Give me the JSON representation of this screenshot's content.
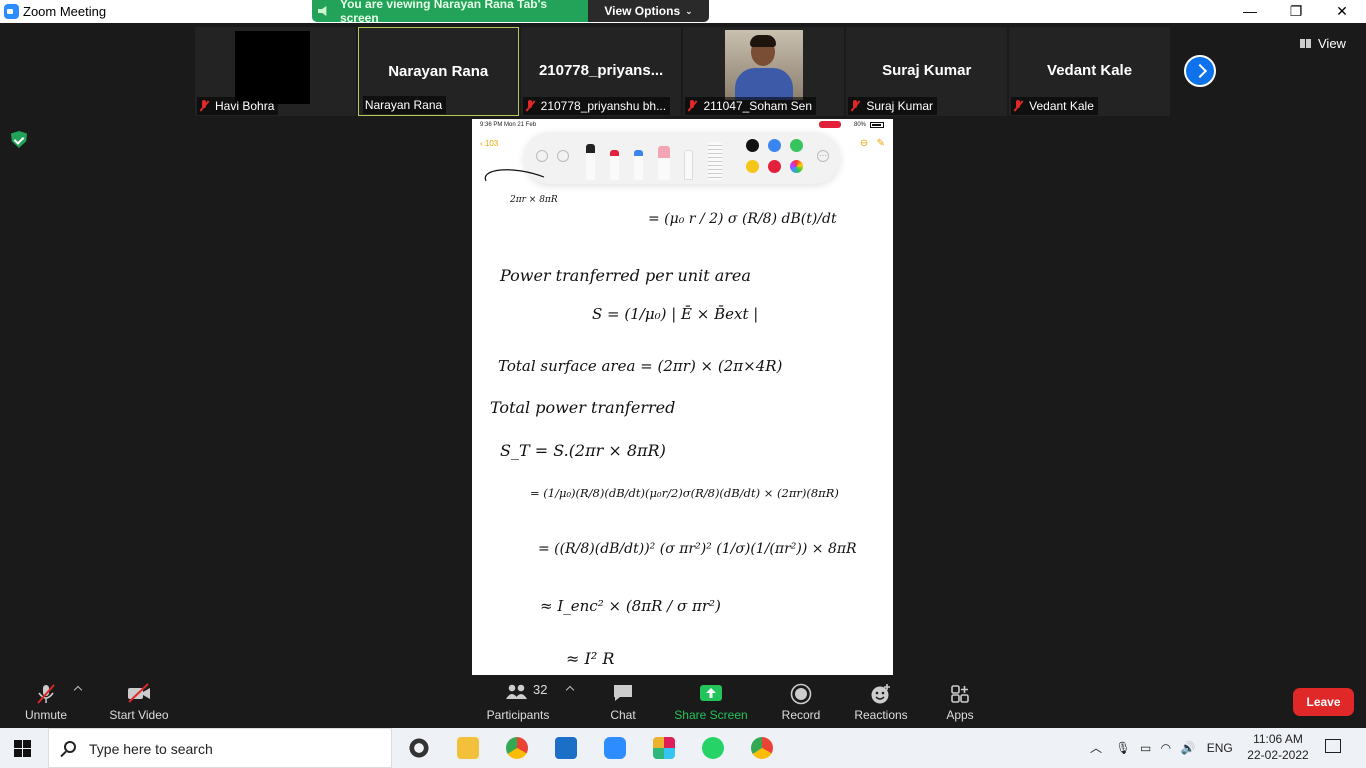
{
  "window": {
    "title": "Zoom Meeting"
  },
  "share_banner": {
    "text": "You are viewing Narayan Rana Tab's screen",
    "view_options": "View Options"
  },
  "participants": [
    {
      "label": "Havi Bohra",
      "muted": true,
      "video": "black"
    },
    {
      "big_name": "Narayan Rana",
      "label": "Narayan Rana",
      "muted": false,
      "active": true
    },
    {
      "big_name": "210778_priyans...",
      "label": "210778_priyanshu bh...",
      "muted": true
    },
    {
      "label": "211047_Soham Sen",
      "muted": true,
      "video": "photo"
    },
    {
      "big_name": "Suraj Kumar",
      "label": "Suraj Kumar",
      "muted": true
    },
    {
      "big_name": "Vedant Kale",
      "label": "Vedant Kale",
      "muted": true
    }
  ],
  "view_button": "View",
  "shared_screen": {
    "status_time": "9:36 PM  Mon 21 Feb",
    "status_battery": "80%",
    "back_count": "103",
    "ink_colors": [
      "#111111",
      "#3a86f0",
      "#37c45c",
      "#f5c518",
      "#e3213b"
    ],
    "handwriting": {
      "l1_left": "2πr × 8πR",
      "l1_right": "= (μ₀ r / 2) σ (R/8) dB(t)/dt",
      "l2": "Power tranferred per unit area",
      "l3": "S = (1/μ₀) | Ē × B̄ext |",
      "l4": "Total surface area = (2πr) × (2π×4R)",
      "l5": "Total power tranferred",
      "l6": "S_T = S.(2πr × 8πR)",
      "l7": "= (1/μ₀)(R/8)(dB/dt)(μ₀r/2)σ(R/8)(dB/dt) × (2πr)(8πR)",
      "l8": "= ((R/8)(dB/dt))² (σ πr²)² (1/σ)(1/(πr²)) × 8πR",
      "l9": "≈ I_enc² × (8πR / σ πr²)",
      "l10": "≈ I² R"
    }
  },
  "controls": {
    "unmute": "Unmute",
    "start_video": "Start Video",
    "participants": "Participants",
    "participant_count": "32",
    "chat": "Chat",
    "share_screen": "Share Screen",
    "record": "Record",
    "reactions": "Reactions",
    "apps": "Apps",
    "leave": "Leave"
  },
  "taskbar": {
    "search_placeholder": "Type here to search",
    "language": "ENG",
    "time": "11:06 AM",
    "date": "22-02-2022"
  }
}
